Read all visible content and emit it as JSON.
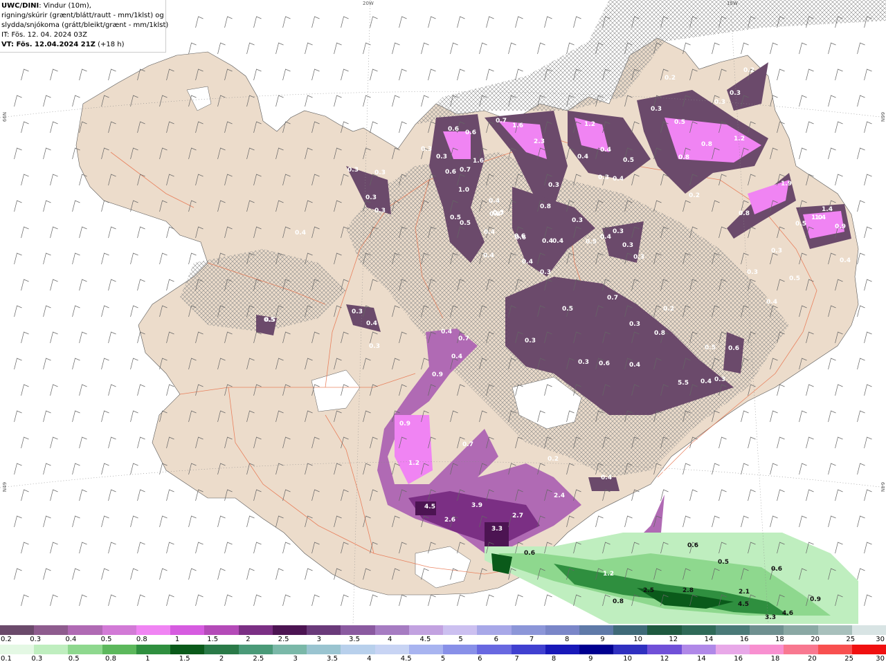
{
  "header": {
    "model": "UWC/DINI",
    "line1_rest": ": Vindur (10m),",
    "line2": "rigning/skúrir (grænt/blátt/rautt - mm/1klst) og",
    "line3": "slydda/snjókoma (grátt/bleikt/grænt - mm/1klst)",
    "issue_time": "IT: Fös. 12. 04. 2024 03Z",
    "valid_prefix": "VT: Fös. 12.04.2024 21Z",
    "valid_suffix": " (+18 h)"
  },
  "grid_labels": {
    "lon_20w": "20W",
    "lon_15w": "15W",
    "lat_66n_left": "66N",
    "lat_66n_right": "66N",
    "lat_64n_left": "N49",
    "lat_64n_right": "64N"
  },
  "colors": {
    "land": "#ecdccb",
    "sea": "#ffffff",
    "roads": "#e8714a",
    "snow_palette": [
      "#6b4a6b",
      "#8e5c8e",
      "#b06ab4",
      "#d27ad6",
      "#f084f3",
      "#d65ce0",
      "#b44ab8",
      "#7b2f84",
      "#4c1452",
      "#6a3a7a",
      "#8a5aa0",
      "#a67cc2",
      "#c2a2e0",
      "#ccc0f0",
      "#a8a8e8",
      "#8c96d8",
      "#7a86c8",
      "#5f7aa8",
      "#3f6a78",
      "#1f5a40",
      "#2f6a58",
      "#4a7a78",
      "#6f9090",
      "#8aa8a4",
      "#a8c0bc",
      "#d8e4e4"
    ],
    "rain_palette": [
      "#e4f8e4",
      "#bfeebf",
      "#8ed88e",
      "#5cb85c",
      "#2f8f3f",
      "#0a5a1a",
      "#2a7a48",
      "#4a9a78",
      "#7ab8a8",
      "#9ac4d0",
      "#b8d0ec",
      "#c8d4f4",
      "#a8b4f0",
      "#8890e8",
      "#6868e0",
      "#4040d0",
      "#1818b8",
      "#000090",
      "#3030c0",
      "#7050d8",
      "#b088e8",
      "#e8a8e8",
      "#f890d0",
      "#f87890",
      "#f85050",
      "#f01010"
    ]
  },
  "legend_snow": {
    "ticks": [
      "0.2",
      "0.3",
      "0.4",
      "0.5",
      "0.8",
      "1",
      "1.5",
      "2",
      "2.5",
      "3",
      "3.5",
      "4",
      "4.5",
      "5",
      "6",
      "7",
      "8",
      "9",
      "10",
      "12",
      "14",
      "16",
      "18",
      "20",
      "25",
      "30"
    ]
  },
  "legend_rain": {
    "ticks": [
      "0.1",
      "0.3",
      "0.5",
      "0.8",
      "1",
      "1.5",
      "2",
      "2.5",
      "3",
      "3.5",
      "4",
      "4.5",
      "5",
      "6",
      "7",
      "8",
      "9",
      "10",
      "12",
      "14",
      "16",
      "18",
      "20",
      "25",
      "30"
    ]
  },
  "snow_labels": [
    {
      "t": "0.6"
    },
    {
      "t": "0.6"
    },
    {
      "t": "0.7"
    },
    {
      "t": "1.6"
    },
    {
      "t": "1.2"
    },
    {
      "t": "0.3"
    },
    {
      "t": "0.2"
    },
    {
      "t": "0.2"
    },
    {
      "t": "0.3"
    },
    {
      "t": "0.3"
    },
    {
      "t": "0.5"
    },
    {
      "t": "2.3"
    },
    {
      "t": "0.4"
    },
    {
      "t": "0.5"
    },
    {
      "t": "0.8"
    },
    {
      "t": "1.2"
    },
    {
      "t": "0.3"
    },
    {
      "t": "0.3"
    },
    {
      "t": "0.3"
    },
    {
      "t": "1.6"
    },
    {
      "t": "0.4"
    },
    {
      "t": "0.3"
    },
    {
      "t": "0.4"
    },
    {
      "t": "0.8"
    },
    {
      "t": "0.3"
    },
    {
      "t": "0.6"
    },
    {
      "t": "0.7"
    },
    {
      "t": "1.0"
    },
    {
      "t": "0.3"
    },
    {
      "t": "0.2"
    },
    {
      "t": "1.9"
    },
    {
      "t": "0.3"
    },
    {
      "t": "0.3"
    },
    {
      "t": "0.8"
    },
    {
      "t": "0.8"
    },
    {
      "t": "0.4"
    },
    {
      "t": "0.5"
    },
    {
      "t": "0.5"
    },
    {
      "t": "0.5"
    },
    {
      "t": "0.8"
    },
    {
      "t": "1.4"
    },
    {
      "t": "1.0"
    },
    {
      "t": "1.4"
    },
    {
      "t": "0.9"
    },
    {
      "t": "0.4"
    },
    {
      "t": "0.7"
    },
    {
      "t": "0.3"
    },
    {
      "t": "0.5"
    },
    {
      "t": "0.4"
    },
    {
      "t": "0.3"
    },
    {
      "t": "0.6"
    },
    {
      "t": "0.4"
    },
    {
      "t": "0.4"
    },
    {
      "t": "0.6"
    },
    {
      "t": "0.5"
    },
    {
      "t": "0.4"
    },
    {
      "t": "0.3"
    },
    {
      "t": "0.3"
    },
    {
      "t": "0.4"
    },
    {
      "t": "0.3"
    },
    {
      "t": "0.4"
    },
    {
      "t": "0.3"
    },
    {
      "t": "0.3"
    },
    {
      "t": "0.5"
    },
    {
      "t": "0.7"
    },
    {
      "t": "0.2"
    },
    {
      "t": "0.4"
    },
    {
      "t": "0.3"
    },
    {
      "t": "0.5"
    },
    {
      "t": "0.4"
    },
    {
      "t": "0.3"
    },
    {
      "t": "0.4"
    },
    {
      "t": "0.8"
    },
    {
      "t": "0.3"
    },
    {
      "t": "0.7"
    },
    {
      "t": "0.3"
    },
    {
      "t": "0.5"
    },
    {
      "t": "0.5"
    },
    {
      "t": "0.6"
    },
    {
      "t": "0.9"
    },
    {
      "t": "5.5"
    },
    {
      "t": "0.4"
    },
    {
      "t": "0.3"
    },
    {
      "t": "0.4"
    },
    {
      "t": "0.6"
    },
    {
      "t": "0.4"
    },
    {
      "t": "0.3"
    },
    {
      "t": "0.9"
    },
    {
      "t": "0.7"
    },
    {
      "t": "1.2"
    },
    {
      "t": "0.4"
    },
    {
      "t": "2.4"
    },
    {
      "t": "4.5"
    },
    {
      "t": "3.9"
    },
    {
      "t": "2.7"
    },
    {
      "t": "2.6"
    },
    {
      "t": "3.3"
    },
    {
      "t": "0.4"
    },
    {
      "t": "0.4"
    },
    {
      "t": "0.2"
    },
    {
      "t": "1.2"
    },
    {
      "t": "0.4"
    },
    {
      "t": "0.5"
    }
  ],
  "rain_labels": [
    {
      "t": "0.6"
    },
    {
      "t": "0.5"
    },
    {
      "t": "0.6"
    },
    {
      "t": "0.6"
    },
    {
      "t": "2.5"
    },
    {
      "t": "2.8"
    },
    {
      "t": "2.1"
    },
    {
      "t": "4.5"
    },
    {
      "t": "0.9"
    },
    {
      "t": "0.8"
    },
    {
      "t": "3.3"
    },
    {
      "t": "4.6"
    }
  ]
}
